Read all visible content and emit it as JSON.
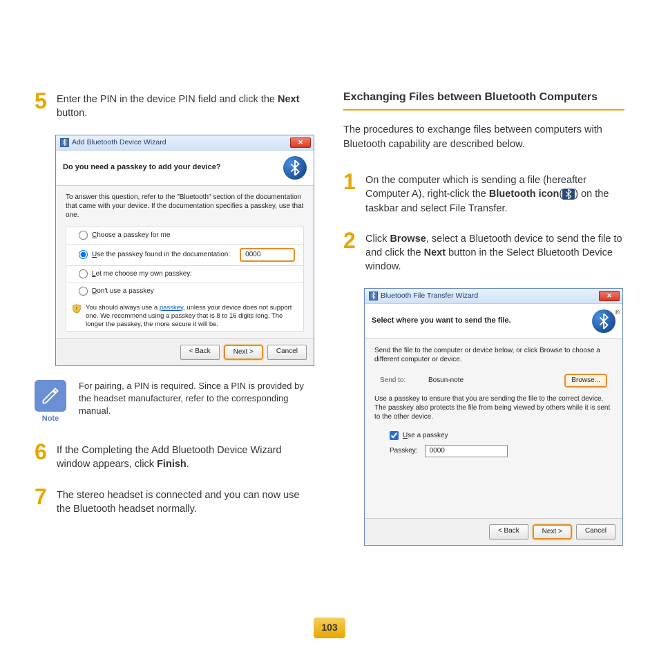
{
  "page_number": "103",
  "left": {
    "step5": {
      "num": "5",
      "text_before": "Enter the PIN in the device PIN field and click the ",
      "bold": "Next",
      "text_after": " button."
    },
    "dialog1": {
      "title": "Add Bluetooth Device Wizard",
      "header": "Do you need a passkey to add your device?",
      "instruction": "To answer this question, refer to the \"Bluetooth\" section of the documentation that came with your device. If the documentation specifies a passkey, use that one.",
      "opt_choose": "Choose a passkey for me",
      "opt_use": "Use the passkey found in the documentation:",
      "opt_use_value": "0000",
      "opt_let": "Let me choose my own passkey:",
      "opt_dont": "Don't use a passkey",
      "warn_before": "You should always use a ",
      "warn_link": "passkey",
      "warn_after": ", unless your device does not support one. We recommend using a passkey that is 8 to 16 digits long. The longer the passkey, the more secure it will be.",
      "btn_back": "< Back",
      "btn_next": "Next >",
      "btn_cancel": "Cancel"
    },
    "note": {
      "label": "Note",
      "text": "For pairing, a PIN is required. Since a PIN is provided by the headset manufacturer, refer to the corresponding manual."
    },
    "step6": {
      "num": "6",
      "text_before": "If the Completing the Add Bluetooth Device Wizard window appears, click ",
      "bold": "Finish",
      "text_after": "."
    },
    "step7": {
      "num": "7",
      "text": "The stereo headset is connected and you can now use the Bluetooth headset normally."
    }
  },
  "right": {
    "section_title": "Exchanging Files between Bluetooth Computers",
    "intro": "The procedures to exchange files between computers with Bluetooth capability are described below.",
    "step1": {
      "num": "1",
      "seg1": "On the computer which is sending a file (hereafter Computer A), right-click the ",
      "bold1": "Bluetooth icon",
      "seg2": "(",
      "seg3": ") on the taskbar and select File Transfer."
    },
    "step2": {
      "num": "2",
      "seg1": "Click ",
      "bold1": "Browse",
      "seg2": ", select a Bluetooth device to send the file to and click the ",
      "bold2": "Next",
      "seg3": " button in the Select Bluetooth Device window."
    },
    "dialog2": {
      "title": "Bluetooth File Transfer Wizard",
      "header": "Select where you want to send the file.",
      "instruction": "Send the file to the computer or device below, or click Browse to choose a different computer or device.",
      "sendto_label": "Send to:",
      "sendto_value": "Bosun-note",
      "browse": "Browse...",
      "passkey_note": "Use a passkey to ensure that you are sending the file to the correct device. The passkey also protects the file from being viewed by others while it is sent to the other device.",
      "use_passkey": "Use a passkey",
      "passkey_label": "Passkey:",
      "passkey_value": "0000",
      "btn_back": "< Back",
      "btn_next": "Next >",
      "btn_cancel": "Cancel"
    }
  }
}
